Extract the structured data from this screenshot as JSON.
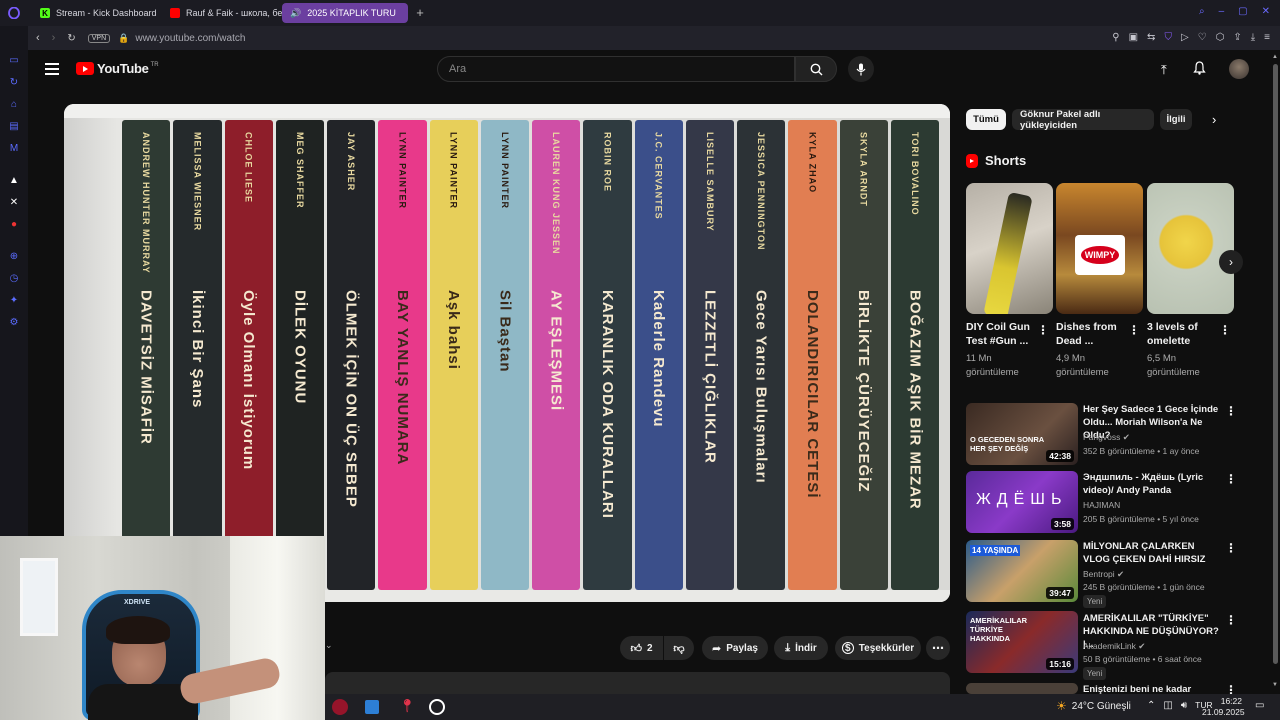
{
  "tabs": [
    {
      "label": "Stream - Kick Dashboard",
      "color": "#53fc18"
    },
    {
      "label": "Rauf & Faik - школа, бер",
      "color": "#ff0000"
    },
    {
      "label": "2025 KİTAPLIK TURU",
      "color": "#ff0000"
    }
  ],
  "address": {
    "vpn": "VPN",
    "url": "www.youtube.com/watch"
  },
  "youtube": {
    "logo_text": "YouTube",
    "region": "TR",
    "search_placeholder": "Ara"
  },
  "books": [
    {
      "author": "ANDREW HUNTER MURRAY",
      "title": "DAVETSİZ MİSAFİR",
      "color": "#2e3a33"
    },
    {
      "author": "MELISSA WIESNER",
      "title": "İkinci Bir Şans",
      "color": "#252a2c"
    },
    {
      "author": "CHLOE LIESE",
      "title": "Öyle Olmanı İstiyorum",
      "color": "#8e1e2a"
    },
    {
      "author": "MEG SHAFFER",
      "title": "DİLEK OYUNU",
      "color": "#1f2322"
    },
    {
      "author": "JAY ASHER",
      "title": "ÖLMEK İÇİN ON ÜÇ SEBEP",
      "color": "#222428"
    },
    {
      "author": "LYNN PAINTER",
      "title": "BAY YANLIŞ NUMARA",
      "color": "#e8398a"
    },
    {
      "author": "LYNN PAINTER",
      "title": "Aşk bahsi",
      "color": "#e7cf5a"
    },
    {
      "author": "LYNN PAINTER",
      "title": "Sil Baştan",
      "color": "#8fb8c6"
    },
    {
      "author": "LAUREN KUNG JESSEN",
      "title": "AY EŞLEŞMESİ",
      "color": "#cf4fa6"
    },
    {
      "author": "ROBIN ROE",
      "title": "KARANLIK ODA KURALLARI",
      "color": "#2f3b40"
    },
    {
      "author": "J.C. CERVANTES",
      "title": "Kaderle Randevu",
      "color": "#3b4f8a"
    },
    {
      "author": "LISELLE SAMBURY",
      "title": "LEZZETLİ ÇIĞLIKLAR",
      "color": "#343848"
    },
    {
      "author": "JESSICA PENNINGTON",
      "title": "Gece Yarısı Buluşmaları",
      "color": "#2c3236"
    },
    {
      "author": "KYLA ZHAO",
      "title": "DOLANDIRICILAR CETESİ",
      "color": "#e17e52"
    },
    {
      "author": "SKYLA ARNDT",
      "title": "BİRLİKTE ÇÜRÜYECEĞİZ",
      "color": "#3a4138"
    },
    {
      "author": "TORI BOVALINO",
      "title": "BOĞAZIM AŞIK BİR MEZAR",
      "color": "#2c3a32"
    }
  ],
  "actions": {
    "likes": "2",
    "share": "Paylaş",
    "download": "İndir",
    "thanks": "Teşekkürler"
  },
  "chips": [
    "Tümü",
    "Göknur Pakel adlı yükleyiciden",
    "İlgili"
  ],
  "shorts_heading": "Shorts",
  "shorts": [
    {
      "title": "DIY Coil Gun Test #Gun ...",
      "views": "11 Mn görüntüleme"
    },
    {
      "title": "Dishes from Dead ...",
      "views": "4,9 Mn görüntüleme",
      "logo": "WIMPY"
    },
    {
      "title": "3 levels of omelette",
      "views": "6,5 Mn görüntüleme"
    }
  ],
  "recommended": [
    {
      "title": "Her Şey Sadece 1 Gece İçinde Oldu... Moriah Wilson'a Ne Oldu?",
      "channel": "Pangvoss",
      "meta": "352 B görüntüleme • 1 ay önce",
      "duration": "42:38",
      "thumb_text": "O GECEDEN SONRA HER ŞEY DEĞİŞ"
    },
    {
      "title": "Эндшпиль - Ждёшь (Lyric video)/ Andy Panda",
      "channel": "HAJIMAN",
      "meta": "205 B görüntüleme • 5 yıl önce",
      "duration": "3:58",
      "thumb_text": "ЖДЁШЬ"
    },
    {
      "title": "MİLYONLAR ÇALARKEN VLOG ÇEKEN DAHİ HIRSIZ",
      "channel": "Bentropi",
      "meta": "245 B görüntüleme • 1 gün önce",
      "duration": "39:47",
      "badge": "Yeni",
      "thumb_text": "14 YAŞINDA"
    },
    {
      "title": "AMERİKALILAR \"TÜRKİYE\" HAKKINDA NE DÜŞÜNÜYOR? |...",
      "channel": "AkademikLink",
      "meta": "50 B görüntüleme • 6 saat önce",
      "duration": "15:16",
      "badge": "Yeni",
      "thumb_text": "AMERİKALILAR TÜRKİYE HAKKINDA"
    },
    {
      "title": "Eniştenizi beni ne kadar tanıyor",
      "channel": "",
      "meta": "",
      "duration": ""
    }
  ],
  "taskbar": {
    "weather": "24°C Güneşli",
    "lang": "TUR",
    "time": "16:22",
    "date": "21.09.2025"
  },
  "webcam": {
    "chair_brand": "XDRIVE"
  }
}
